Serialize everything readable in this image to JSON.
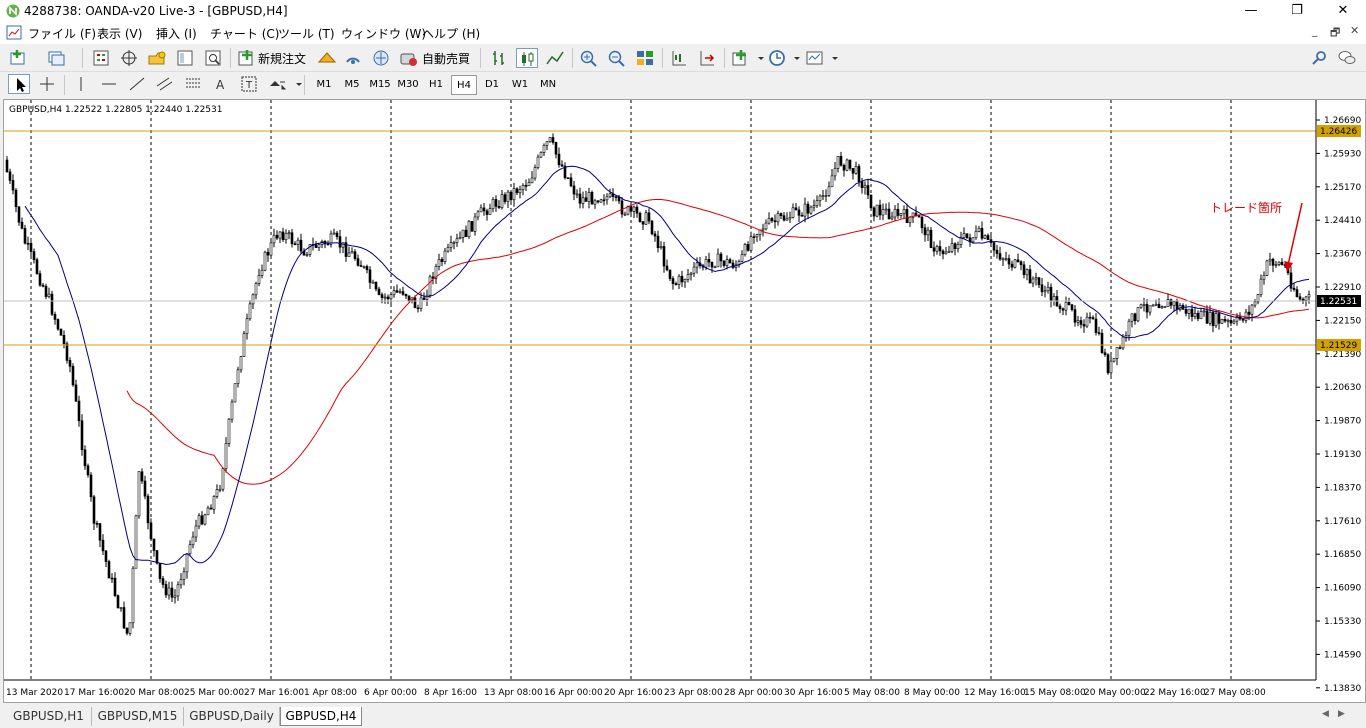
{
  "window": {
    "title": "4288738: OANDA-v20 Live-3 - [GBPUSD,H4]",
    "minimize": "—",
    "maximize": "❐",
    "close": "✕"
  },
  "menu": {
    "items": [
      "ファイル (F)",
      "表示 (V)",
      "挿入 (I)",
      "チャート (C)",
      "ツール (T)",
      "ウィンドウ (W)",
      "ヘルプ (H)"
    ],
    "mdi_minimize": "_",
    "mdi_restore": "🗗",
    "mdi_close": "✕"
  },
  "toolbar": {
    "new_order": "新規注文",
    "auto_trading": "自動売買"
  },
  "timeframes": {
    "items": [
      "M1",
      "M5",
      "M15",
      "M30",
      "H1",
      "H4",
      "D1",
      "W1",
      "MN"
    ],
    "active": "H4"
  },
  "chart": {
    "info": "GBPUSD,H4  1.22522 1.22805 1.22440 1.22531",
    "annotation": "トレード箇所",
    "current_price": "1.22531",
    "hline_upper": "1.26426",
    "hline_lower": "1.21529",
    "colors": {
      "hline": "#d4a000",
      "ma_slow": "#e00000",
      "ma_fast": "#000080",
      "annotation": "#e00000"
    },
    "price_labels": [
      "1.26690",
      "1.25930",
      "1.25170",
      "1.24410",
      "1.23670",
      "1.22910",
      "1.22150",
      "1.21390",
      "1.20630",
      "1.19870",
      "1.19130",
      "1.18370",
      "1.17610",
      "1.16850",
      "1.16090",
      "1.15330",
      "1.14590",
      "1.13830"
    ],
    "time_labels": [
      "13 Mar 2020",
      "17 Mar 16:00",
      "20 Mar 08:00",
      "25 Mar 00:00",
      "27 Mar 16:00",
      "1 Apr 08:00",
      "6 Apr 00:00",
      "8 Apr 16:00",
      "13 Apr 08:00",
      "16 Apr 00:00",
      "20 Apr 16:00",
      "23 Apr 08:00",
      "28 Apr 00:00",
      "30 Apr 16:00",
      "5 May 08:00",
      "8 May 00:00",
      "12 May 16:00",
      "15 May 08:00",
      "20 May 00:00",
      "22 May 16:00",
      "27 May 08:00"
    ]
  },
  "tabs": [
    "GBPUSD,H1",
    "GBPUSD,M15",
    "GBPUSD,Daily",
    "GBPUSD,H4"
  ]
}
